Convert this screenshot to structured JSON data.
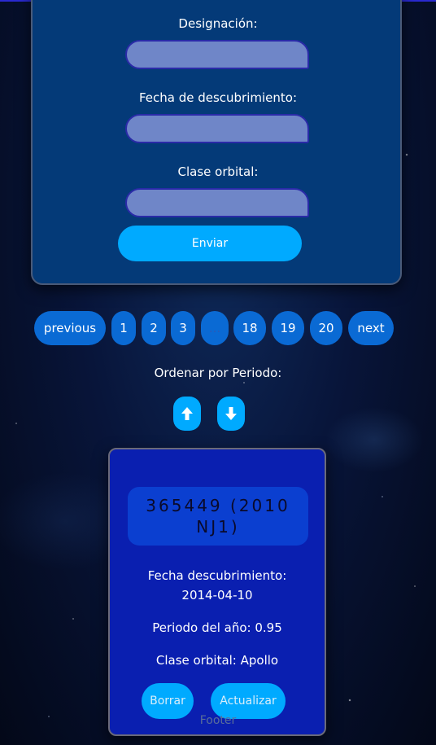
{
  "form": {
    "designation_label": "Designación:",
    "designation_value": "",
    "date_label": "Fecha de descubrimiento:",
    "date_value": "",
    "orbit_label": "Clase orbital:",
    "orbit_value": "",
    "submit_label": "Enviar"
  },
  "pagination": {
    "previous": "previous",
    "pages": [
      "1",
      "2",
      "3",
      "...",
      "18",
      "19",
      "20"
    ],
    "next": "next"
  },
  "sort": {
    "label": "Ordenar por Periodo:",
    "up_icon": "arrow-up-icon",
    "down_icon": "arrow-down-icon"
  },
  "asteroid": {
    "name": "365449 (2010 NJ1)",
    "discovery_label": "Fecha descubrimiento:",
    "discovery_date": "2014-04-10",
    "period_text": "Periodo del año: 0.95",
    "orbit_text": "Clase orbital: Apollo",
    "delete_label": "Borrar",
    "update_label": "Actualizar"
  },
  "footer": "Footer",
  "colors": {
    "accent": "#00aaff",
    "pager": "#0a6ad4",
    "card": "#0a1fb0",
    "form_card": "#043a78"
  }
}
